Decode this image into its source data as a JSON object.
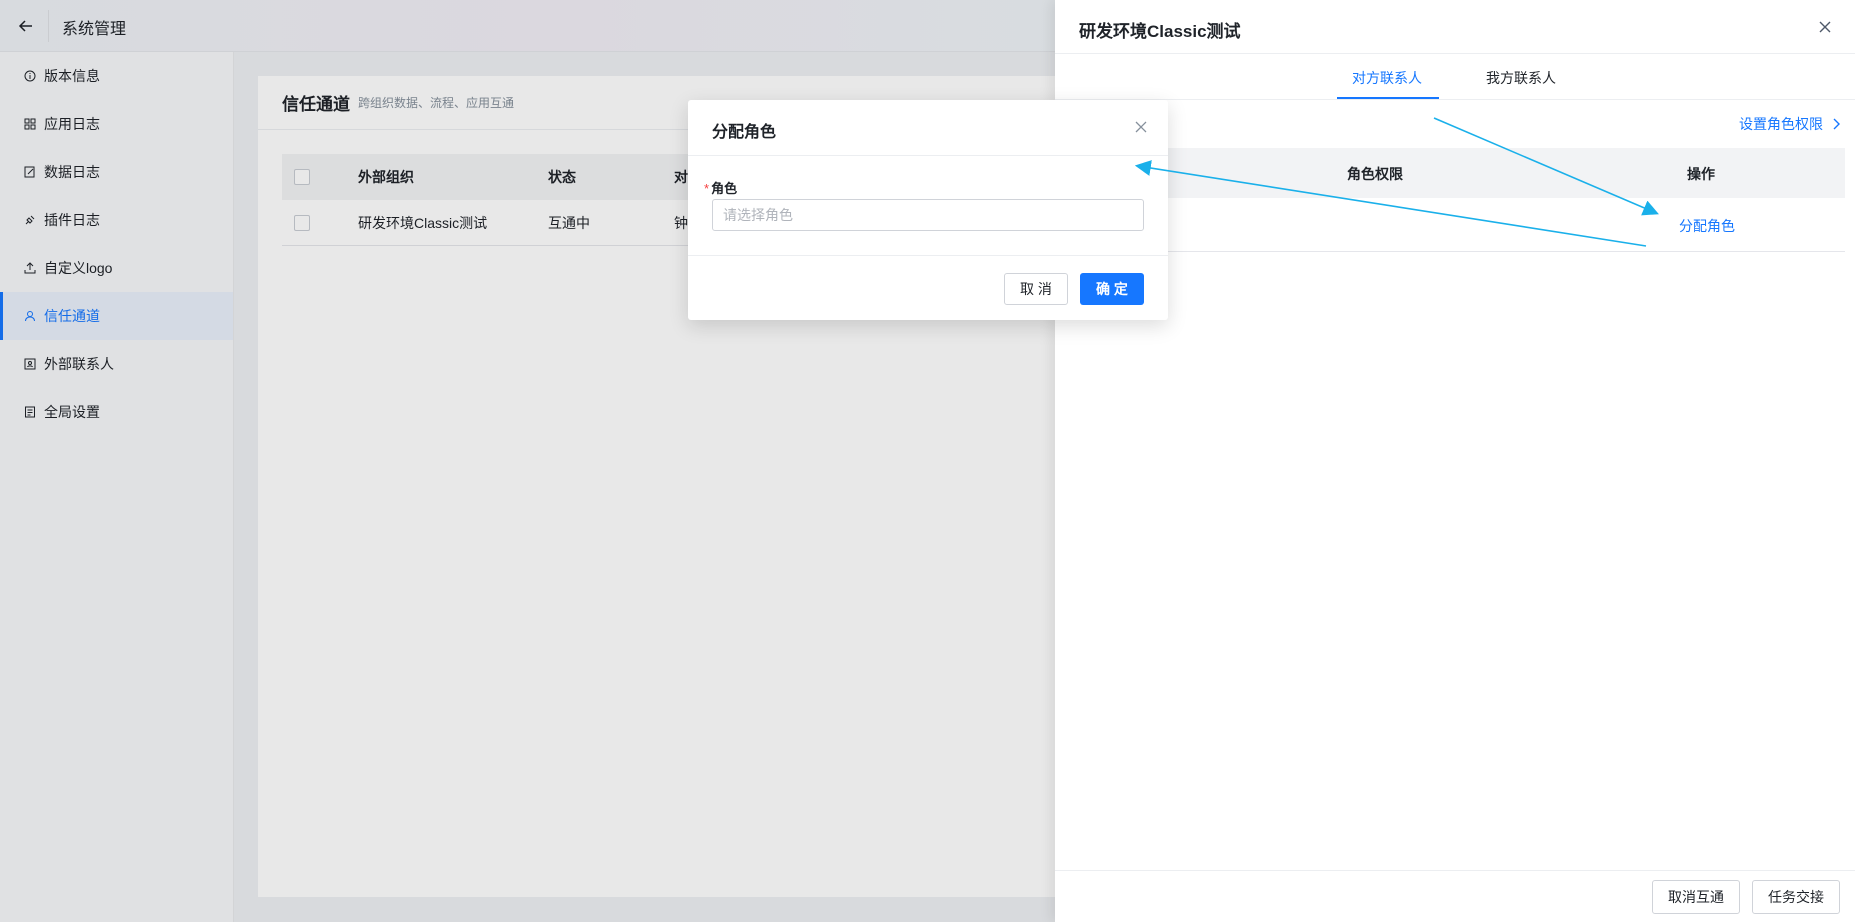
{
  "header": {
    "title": "系统管理"
  },
  "sidebar": {
    "items": [
      {
        "label": "版本信息",
        "icon": "info-icon"
      },
      {
        "label": "应用日志",
        "icon": "grid-icon"
      },
      {
        "label": "数据日志",
        "icon": "edit-doc-icon"
      },
      {
        "label": "插件日志",
        "icon": "plug-icon"
      },
      {
        "label": "自定义logo",
        "icon": "upload-icon"
      },
      {
        "label": "信任通道",
        "icon": "people-icon",
        "active": true
      },
      {
        "label": "外部联系人",
        "icon": "contact-card-icon"
      },
      {
        "label": "全局设置",
        "icon": "settings-doc-icon"
      }
    ]
  },
  "main": {
    "title": "信任通道",
    "subtitle": "跨组织数据、流程、应用互通",
    "table": {
      "columns": [
        "外部组织",
        "状态",
        "对"
      ],
      "rows": [
        {
          "org": "研发环境Classic测试",
          "status": "互通中",
          "peer": "钟"
        }
      ]
    }
  },
  "drawer": {
    "title": "研发环境Classic测试",
    "tabs": [
      {
        "label": "对方联系人",
        "active": true
      },
      {
        "label": "我方联系人",
        "active": false
      }
    ],
    "set_permission": "设置角色权限",
    "columns": {
      "role_permission": "角色权限",
      "action": "操作"
    },
    "row_action": "分配角色",
    "footer": {
      "cancel_interop": "取消互通",
      "task_handover": "任务交接"
    }
  },
  "modal": {
    "title": "分配角色",
    "field_label": "角色",
    "field_required_mark": "*",
    "placeholder": "请选择角色",
    "cancel": "取 消",
    "confirm": "确 定"
  },
  "colors": {
    "accent": "#1677ff",
    "annotation_arrow": "#1ab0ea"
  }
}
